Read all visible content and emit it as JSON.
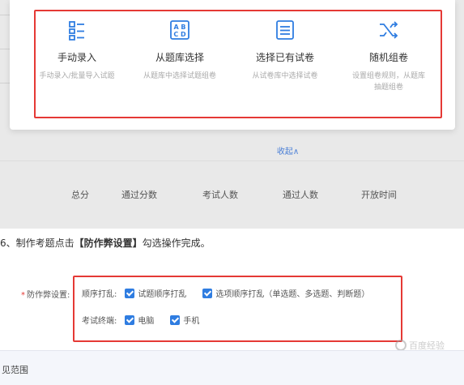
{
  "modal": {
    "options": [
      {
        "icon": "list-icon",
        "title": "手动录入",
        "desc": "手动录入/批量导入试题"
      },
      {
        "icon": "abcd-icon",
        "title": "从题库选择",
        "desc": "从题库中选择试题组卷"
      },
      {
        "icon": "document-icon",
        "title": "选择已有试卷",
        "desc": "从试卷库中选择试卷"
      },
      {
        "icon": "shuffle-icon",
        "title": "随机组卷",
        "desc": "设置组卷规则，从题库抽题组卷"
      }
    ]
  },
  "collapse_label": "收起∧",
  "table": {
    "headers": [
      "总分",
      "通过分数",
      "考试人数",
      "通过人数",
      "开放时间"
    ]
  },
  "step": {
    "prefix": "6、制作考题点击",
    "highlight": "【防作弊设置】",
    "suffix": "勾选操作完成。"
  },
  "anticheat": {
    "label": "防作弊设置:",
    "order_label": "顺序打乱:",
    "order_opt1": "试题顺序打乱",
    "order_opt2": "选项顺序打乱（单选题、多选题、判断题）",
    "terminal_label": "考试终端:",
    "terminal_opt1": "电脑",
    "terminal_opt2": "手机"
  },
  "bottom_label": "见范围",
  "watermark": "百度经验",
  "colors": {
    "accent": "#2f7de1",
    "highlight_box": "#e53935",
    "link": "#4a7fd6"
  }
}
